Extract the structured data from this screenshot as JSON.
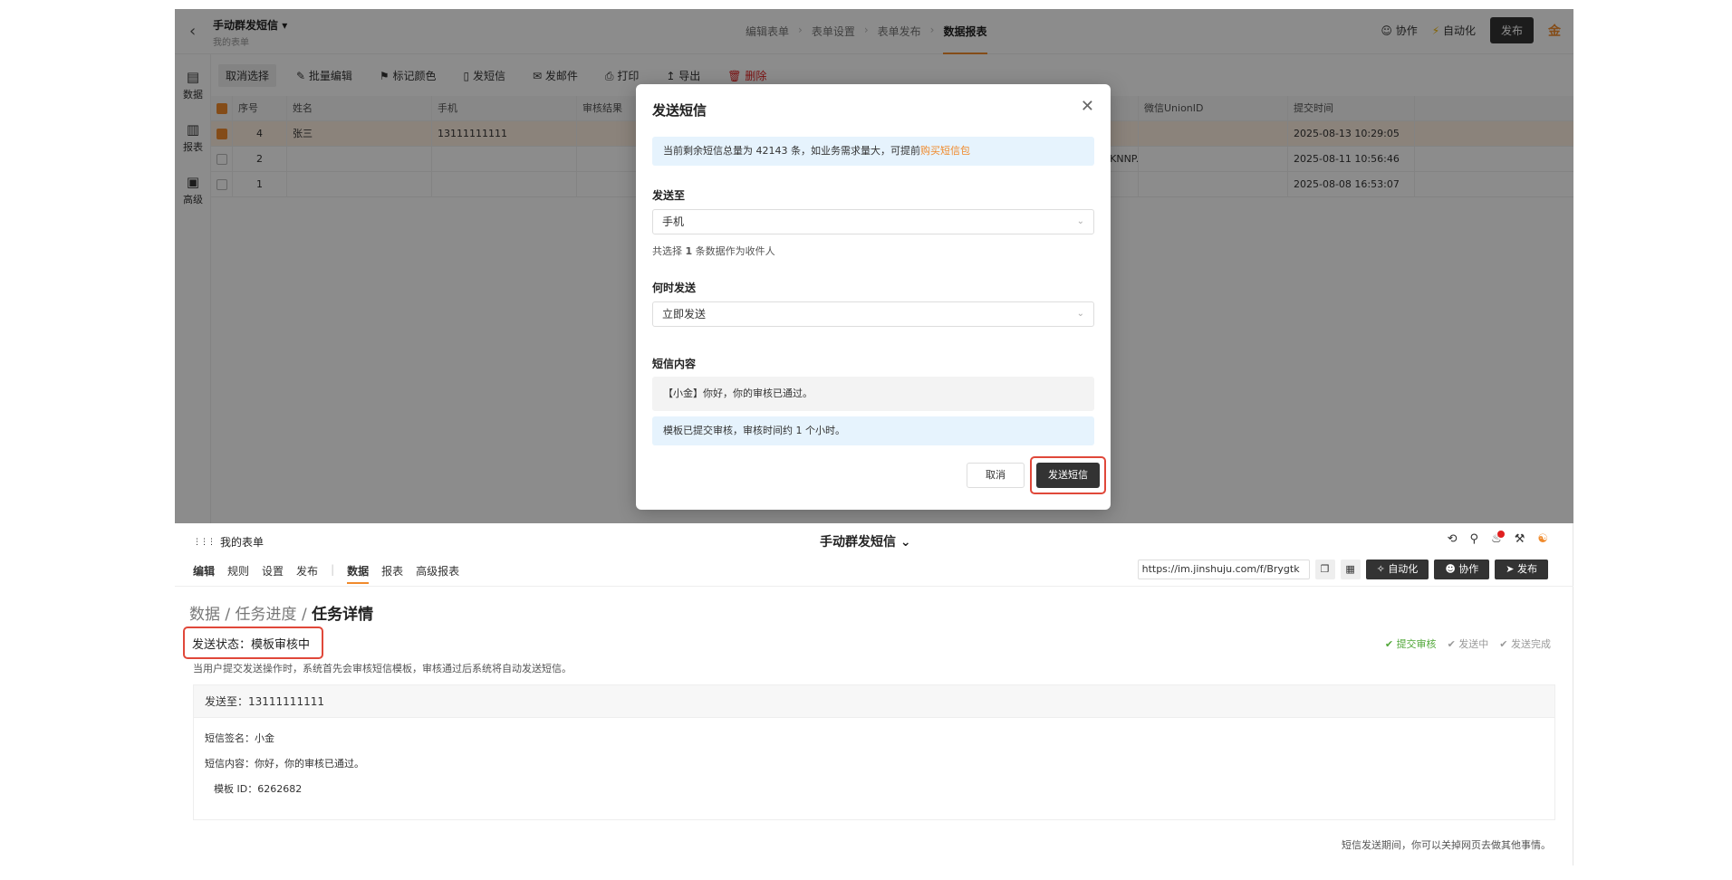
{
  "top": {
    "header": {
      "back_icon": "‹",
      "title": "手动群发短信",
      "title_caret": "▾",
      "subtitle": "我的表单",
      "steps": [
        "编辑表单",
        "表单设置",
        "表单发布",
        "数据报表"
      ],
      "step_sep": "›",
      "collab": "协作",
      "automation": "自动化",
      "publish": "发布",
      "logo": "金"
    },
    "sidebar": [
      {
        "icon": "▤",
        "label": "数据"
      },
      {
        "icon": "▥",
        "label": "报表"
      },
      {
        "icon": "▣",
        "label": "高级"
      }
    ],
    "toolbar": {
      "deselect": "取消选择",
      "batch_edit": "批量编辑",
      "mark_color": "标记颜色",
      "send_sms": "发短信",
      "send_email": "发邮件",
      "print": "打印",
      "export": "导出",
      "delete": "删除"
    },
    "table": {
      "headers": [
        "序号",
        "姓名",
        "手机",
        "审核结果",
        "",
        "微信UnionID",
        "提交时间"
      ],
      "rows": [
        {
          "no": "4",
          "name": "张三",
          "phone": "13111111111",
          "review": "",
          "mid": "",
          "union": "",
          "time": "2025-08-13 10:29:05"
        },
        {
          "no": "2",
          "name": "",
          "phone": "",
          "review": "",
          "mid": "'ciKNNP.",
          "union": "",
          "time": "2025-08-11 10:56:46"
        },
        {
          "no": "1",
          "name": "",
          "phone": "",
          "review": "",
          "mid": "",
          "union": "",
          "time": "2025-08-08 16:53:07"
        }
      ]
    },
    "modal": {
      "title": "发送短信",
      "close": "✕",
      "info_text": "当前剩余短信总量为 42143 条，如业务需求量大，可提前",
      "info_link": "购买短信包",
      "send_to_label": "发送至",
      "send_to_value": "手机",
      "recipients_prefix": "共选择 ",
      "recipients_count": "1",
      "recipients_suffix": " 条数据作为收件人",
      "when_label": "何时发送",
      "when_value": "立即发送",
      "content_label": "短信内容",
      "content_value": "【小金】你好，你的审核已通过。",
      "notice": "模板已提交审核，审核时间约 1 个小时。",
      "cancel": "取消",
      "send": "发送短信"
    }
  },
  "bottom": {
    "header": {
      "apps_icon": "⋮⋮⋮",
      "apps_label": "我的表单",
      "title": "手动群发短信",
      "title_chevron": "⌄",
      "tabs": [
        "编辑",
        "规则",
        "设置",
        "发布",
        "数据",
        "报表",
        "高级报表"
      ],
      "url": "https://im.jinshuju.com/f/Brygtk",
      "automation": "自动化",
      "collab": "协作",
      "publish": "发布"
    },
    "breadcrumb": {
      "a": "数据",
      "b": "任务进度",
      "c": "任务详情",
      "sep": " / "
    },
    "status": "发送状态：模板审核中",
    "description": "当用户提交发送操作时，系统首先会审核短信模板，审核通过后系统将自动发送短信。",
    "progress_steps": [
      "提交审核",
      "发送中",
      "发送完成"
    ],
    "panel": {
      "send_to": "发送至：13111111111",
      "signature": "短信签名：小金",
      "content": "短信内容：你好，你的审核已通过。",
      "template_id": "模板 ID：6262682"
    },
    "footer": "短信发送期间，你可以关掉网页去做其他事情。"
  },
  "colors": {
    "accent": "#f08a2c",
    "highlight": "#e0483a",
    "success": "#52a83a"
  }
}
